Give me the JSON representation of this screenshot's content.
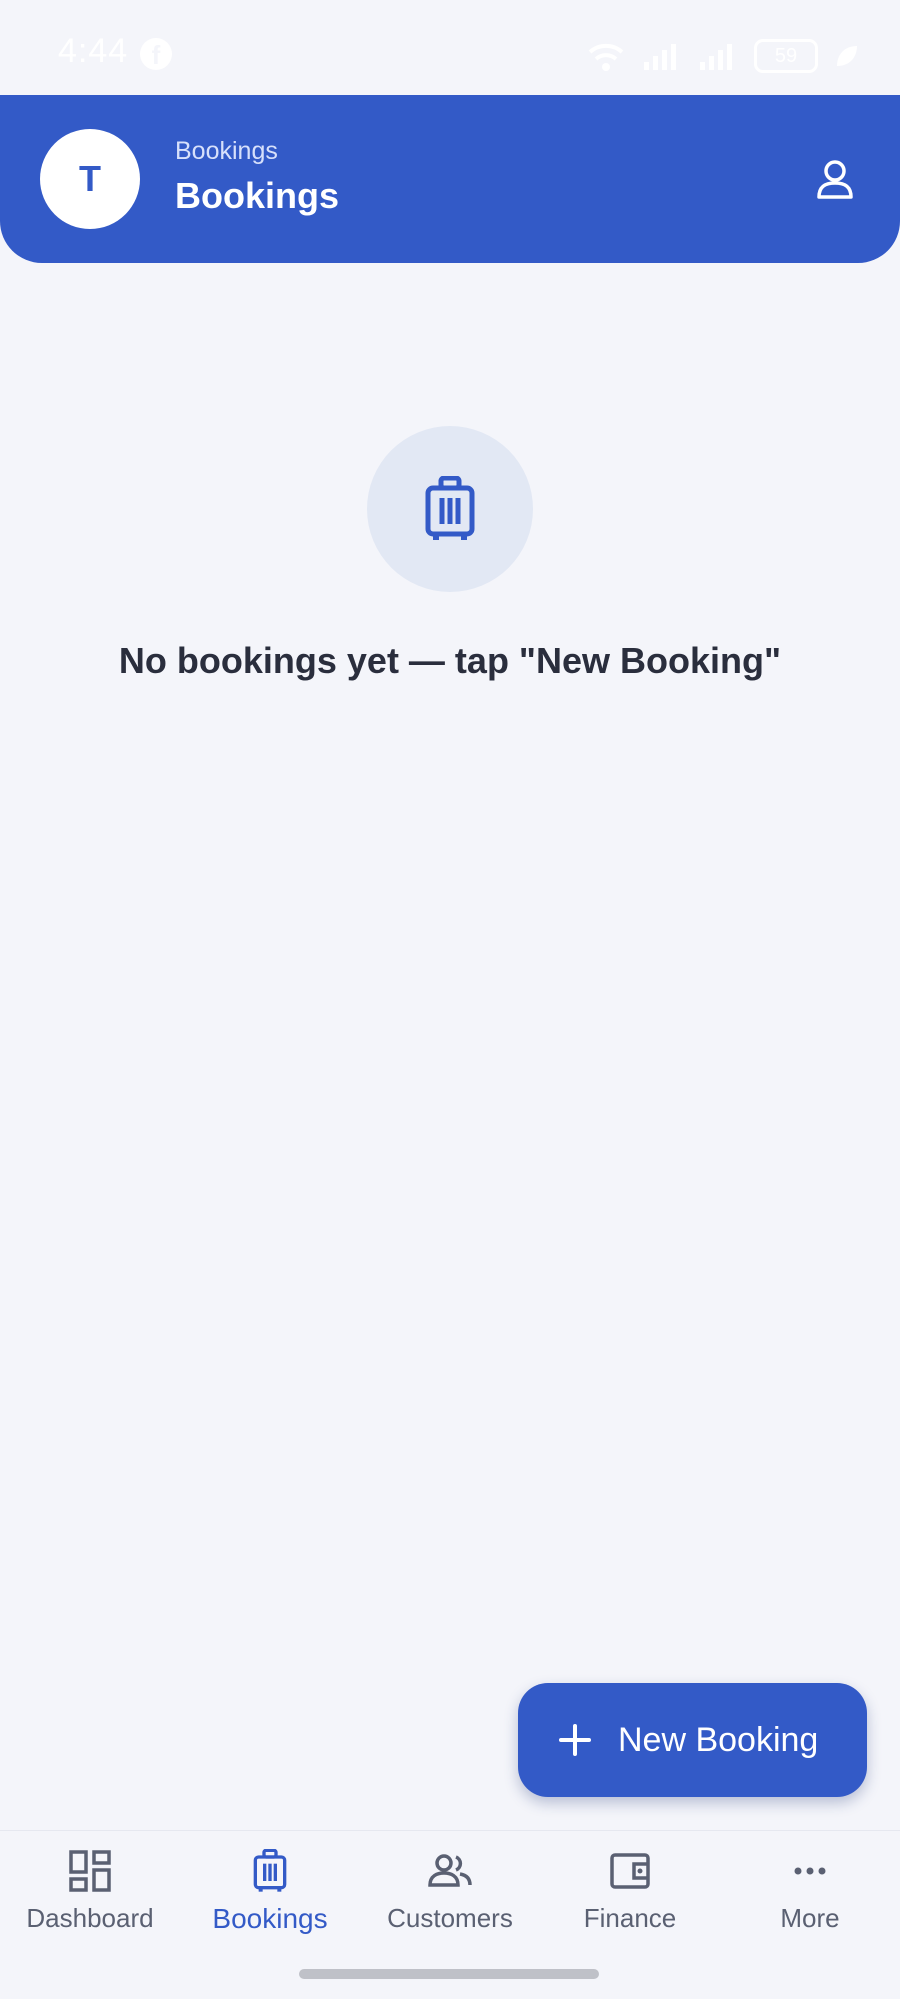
{
  "status_bar": {
    "time": "4:44",
    "battery": "59",
    "app_icon": "facebook-icon"
  },
  "header": {
    "avatar_initial": "T",
    "subtitle": "Bookings",
    "title": "Bookings",
    "profile_icon": "person-icon"
  },
  "empty_state": {
    "icon": "luggage-icon",
    "message": "No bookings yet — tap \"New Booking\""
  },
  "fab": {
    "icon": "plus-icon",
    "label": "New Booking"
  },
  "bottom_nav": {
    "active": "Bookings",
    "items": [
      {
        "label": "Dashboard",
        "icon": "dashboard-icon"
      },
      {
        "label": "Bookings",
        "icon": "luggage-icon"
      },
      {
        "label": "Customers",
        "icon": "people-icon"
      },
      {
        "label": "Finance",
        "icon": "wallet-icon"
      },
      {
        "label": "More",
        "icon": "more-icon"
      }
    ]
  },
  "colors": {
    "primary": "#335ac7",
    "background": "#f4f5fa",
    "text": "#2a2e3d",
    "muted": "#5a6072"
  }
}
